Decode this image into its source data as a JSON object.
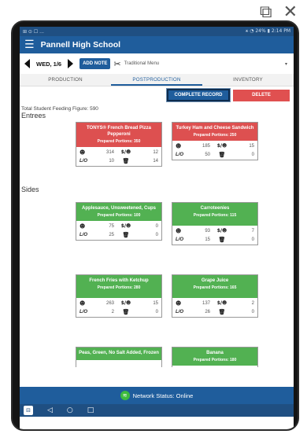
{
  "window_controls": {
    "popout_icon": "popout-icon",
    "close_icon": "close-icon",
    "popout_glyph": "⧉",
    "close_glyph": "✕"
  },
  "status_bar": {
    "left": "⊞ ⊙ ☐ ...",
    "right": "⚹ ◔ 24% ▮ 2:14 PM"
  },
  "app_bar": {
    "title": "Pannell High School"
  },
  "date_bar": {
    "date": "WED, 1/6",
    "add_note": "ADD NOTE",
    "menu": "Traditional Menu",
    "caret": "▾"
  },
  "tabs": [
    {
      "label": "PRODUCTION"
    },
    {
      "label": "POSTPRODUCTION"
    },
    {
      "label": "INVENTORY"
    }
  ],
  "actions": {
    "complete": "COMPLETE RECORD",
    "delete": "DELETE"
  },
  "feeding_figure": "Total Student Feeding Figure: 590",
  "sections": {
    "entrees": "Entrees",
    "sides": "Sides"
  },
  "card_labels": {
    "lo": "L/O",
    "dollar": "$/☻",
    "served_icon": "☻",
    "trash_icon": "🗑"
  },
  "cards": [
    {
      "title": "TONYS® French Bread Pizza Pepperoni",
      "portions": "Prepared Portions: 350",
      "served": "314",
      "cost": "12",
      "lo": "10",
      "waste": "14"
    },
    {
      "title": "Turkey Ham and Cheese Sandwich",
      "portions": "Prepared Portions: 250",
      "served": "185",
      "cost": "15",
      "lo": "50",
      "waste": "0"
    },
    {
      "title": "Applesauce, Unsweetened, Cups",
      "portions": "Prepared Portions: 100",
      "served": "75",
      "cost": "0",
      "lo": "25",
      "waste": "0"
    },
    {
      "title": "Carroteenies",
      "portions": "Prepared Portions: 115",
      "served": "93",
      "cost": "7",
      "lo": "15",
      "waste": "0"
    },
    {
      "title": "French Fries with Ketchup",
      "portions": "Prepared Portions: 280",
      "served": "263",
      "cost": "15",
      "lo": "2",
      "waste": "0"
    },
    {
      "title": "Grape Juice",
      "portions": "Prepared Portions: 165",
      "served": "137",
      "cost": "2",
      "lo": "26",
      "waste": "0"
    },
    {
      "title": "Peas, Green, No Salt Added, Frozen",
      "portions": "",
      "served": "",
      "cost": "",
      "lo": "",
      "waste": ""
    },
    {
      "title": "Banana",
      "portions": "Prepared Portions: 180",
      "served": "",
      "cost": "",
      "lo": "",
      "waste": ""
    }
  ],
  "network": {
    "label": "Network Status: Online",
    "wifi_glyph": "≋"
  },
  "nav": {
    "logo": "⊟",
    "back": "◁",
    "home": "○",
    "recent": "□"
  },
  "colors": {
    "primary": "#1f5d9c",
    "red": "#dd5050",
    "green": "#52b152"
  }
}
